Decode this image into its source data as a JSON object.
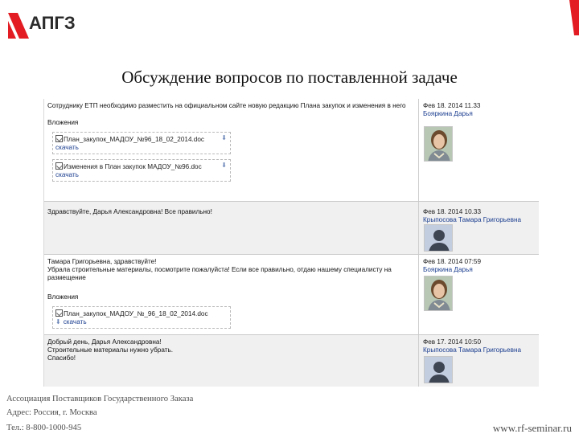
{
  "brand": {
    "logo_text": "АПГЗ",
    "accent_color": "#e21c22"
  },
  "slide_title": "Обсуждение вопросов по поставленной задаче",
  "messages": [
    {
      "text": "Сотруднику ЕТП необходимо разместить на официальном сайте новую редакцию Плана закупок и изменения в него",
      "date": "Фев 18. 2014 11.33",
      "author": "Бояркина Дарья",
      "attachments_label": "Вложения",
      "attachments": [
        {
          "file": "План_закупок_МАДОУ_№96_18_02_2014.doc",
          "download": "скачать"
        },
        {
          "file": "Изменения в План закупок МАДОУ_№96.doc",
          "download": "скачать"
        }
      ],
      "avatar": "photo"
    },
    {
      "text": "Здравствуйте, Дарья Александровна! Все правильно!",
      "date": "Фев 18. 2014 10.33",
      "author": "Крыпосова Тамара Григорьевна",
      "avatar": "anonymous"
    },
    {
      "lines": [
        "Тамара Григорьевна, здравствуйте!",
        "Убрала строительные материалы, посмотрите пожалуйста! Если все правильно, отдаю нашему специалисту на размещение"
      ],
      "date": "Фев 18. 2014 07:59",
      "author": "Бояркина Дарья",
      "attachments_label": "Вложения",
      "attachments": [
        {
          "file": "План_закупок_МАДОУ_№_96_18_02_2014.doc",
          "download": "скачать"
        }
      ],
      "avatar": "photo"
    },
    {
      "lines": [
        "Добрый день, Дарья Александровна!",
        " Строительные материалы нужно убрать.",
        "Спасибо!"
      ],
      "date": "Фев 17. 2014 10:50",
      "author": "Крыпосова Тамара Григорьевна",
      "avatar": "anonymous"
    }
  ],
  "footer": {
    "org": "Ассоциация Поставщиков Государственного Заказа",
    "address": "Адрес: Россия, г. Москва",
    "phone": "Тел.: 8-800-1000-945",
    "site": "www.rf-seminar.ru"
  }
}
